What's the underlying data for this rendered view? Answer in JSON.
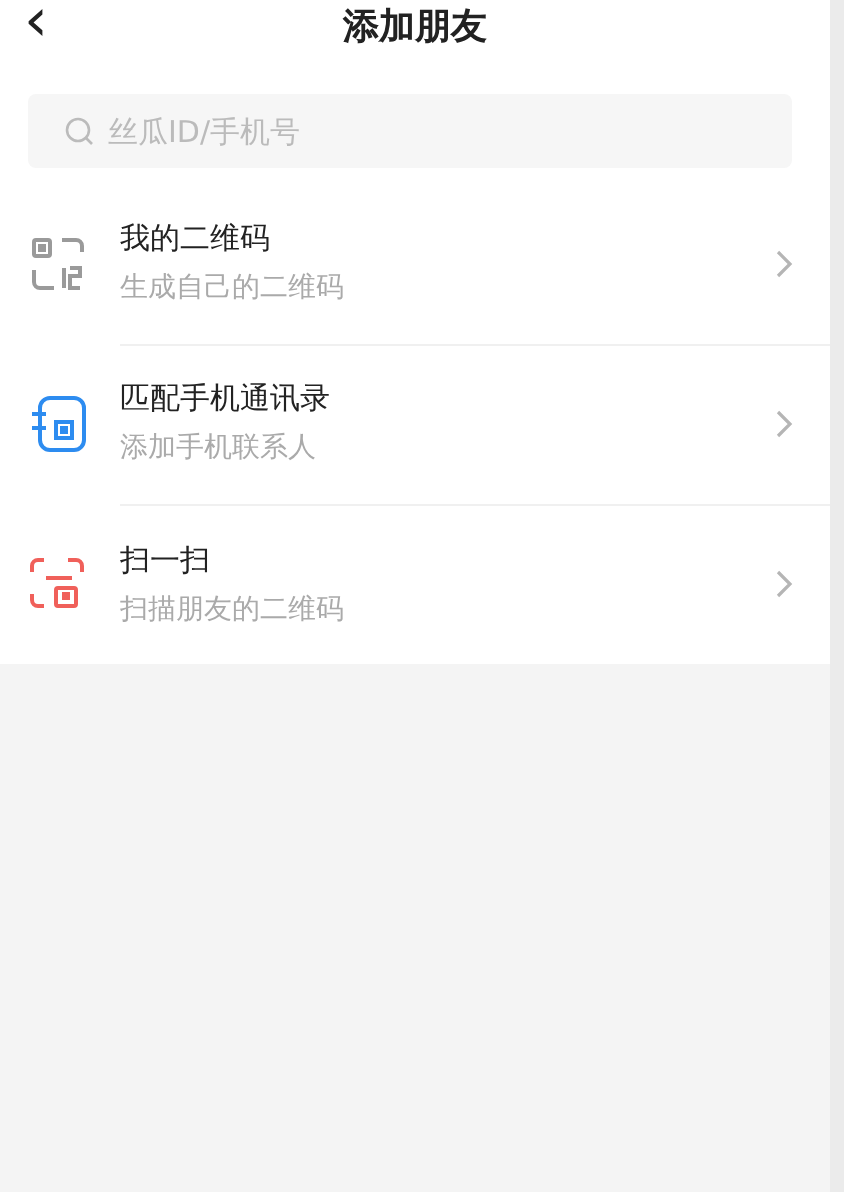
{
  "header": {
    "back": "‹",
    "title": "添加朋友"
  },
  "search": {
    "placeholder": "丝瓜ID/手机号"
  },
  "items": [
    {
      "kind": "qr",
      "color": "#9a9a9a",
      "title": "我的二维码",
      "subtitle": "生成自己的二维码"
    },
    {
      "kind": "contacts",
      "color": "#2d8cf0",
      "title": "匹配手机通讯录",
      "subtitle": "添加手机联系人"
    },
    {
      "kind": "scan",
      "color": "#f0605a",
      "title": "扫一扫",
      "subtitle": "扫描朋友的二维码"
    }
  ]
}
